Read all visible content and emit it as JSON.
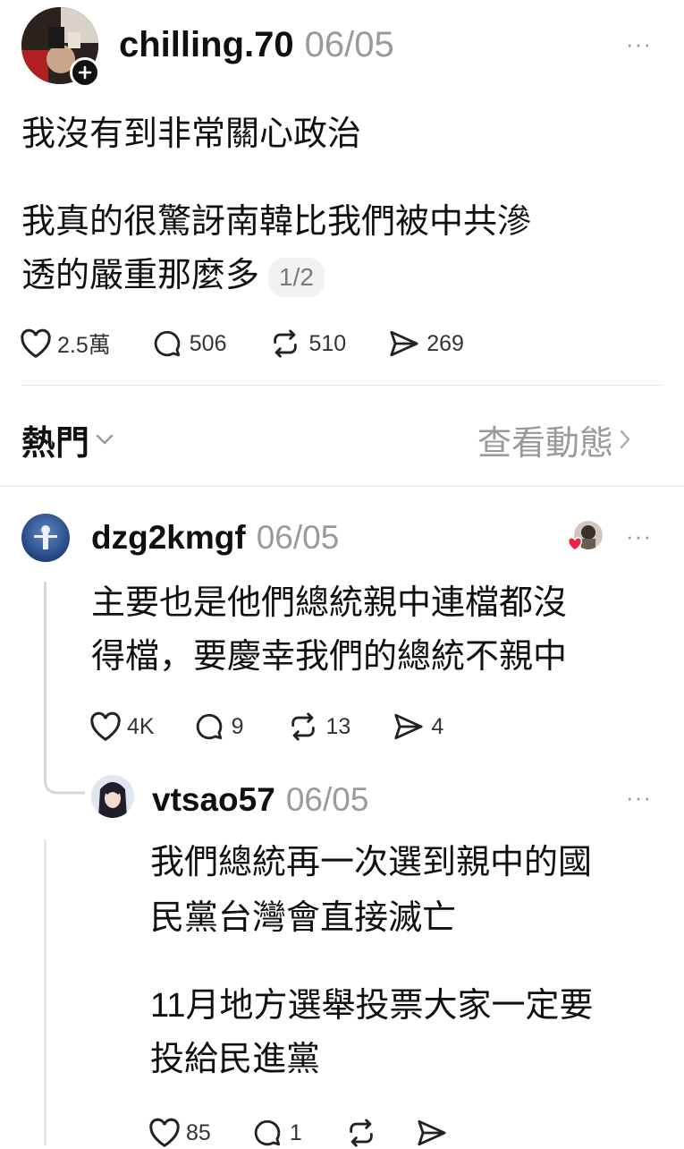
{
  "post": {
    "username": "chilling.70",
    "date": "06/05",
    "more": "···",
    "line1": "我沒有到非常關心政治",
    "line2a": "我真的很驚訝南韓比我們被中共滲",
    "line2b": "透的嚴重那麼多",
    "page_badge": "1/2",
    "likes": "2.5萬",
    "replies": "506",
    "reposts": "510",
    "shares": "269"
  },
  "sort": {
    "label": "熱門",
    "view_activity": "查看動態"
  },
  "comment1": {
    "username": "dzg2kmgf",
    "date": "06/05",
    "more": "···",
    "line1": "主要也是他們總統親中連檔都沒",
    "line2": "得檔，要慶幸我們的總統不親中",
    "likes": "4K",
    "replies": "9",
    "reposts": "13",
    "shares": "4"
  },
  "reply1": {
    "username": "vtsao57",
    "date": "06/05",
    "more": "···",
    "line1": "我們總統再一次選到親中的國",
    "line2": "民黨台灣會直接滅亡",
    "line3": "11月地方選舉投票大家一定要",
    "line4": "投給民進黨",
    "likes": "85",
    "replies": "1"
  },
  "icons": {
    "like": "heart-icon",
    "reply": "comment-bubble-icon",
    "repost": "repost-icon",
    "share": "send-icon",
    "follow": "plus-icon",
    "chevron_down": "chevron-down-icon",
    "chevron_right": "chevron-right-icon"
  }
}
